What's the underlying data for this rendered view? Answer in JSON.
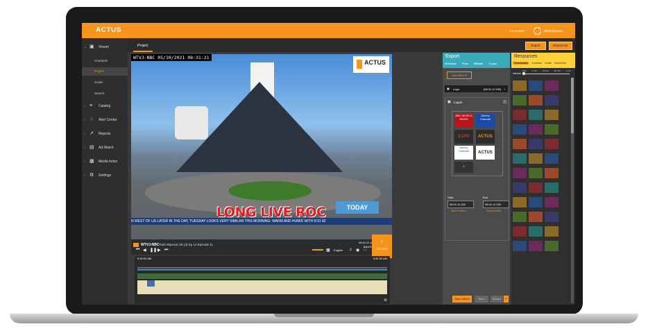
{
  "app": {
    "logo_text": "ACTUS",
    "topbar_info": "v.1.0.2020",
    "user": "admin@actus"
  },
  "sidebar": {
    "viewer": "Viewer",
    "viewer_items": [
      "Channels",
      "Project",
      "Guide",
      "Search"
    ],
    "active_item": "Project",
    "items": [
      {
        "label": "Catalog",
        "icon": "list-icon"
      },
      {
        "label": "Alert Center",
        "icon": "bell-icon"
      },
      {
        "label": "Reports",
        "icon": "chart-line-icon"
      },
      {
        "label": "Ad Watch",
        "icon": "document-icon"
      },
      {
        "label": "Media Index",
        "icon": "media-icon"
      },
      {
        "label": "Settings",
        "icon": "gear-icon"
      }
    ]
  },
  "header": {
    "project_tab": "Project",
    "export_btn": "Export",
    "resources_btn": "Resources"
  },
  "video": {
    "timestamp": "WTVJ-NBC  05/10/2021 08:31:21",
    "overlay_logo": "ACTUS",
    "banner": "LONG LIVE ROC",
    "today_badge": "TODAY",
    "ticker": "N WEST OF US LATER IN THE DAY, TUESDAY LOOKS VERY SIMILAR    THIS MORNING: WARM AND HUMID WITH   8:31  82"
  },
  "player": {
    "channel": "WTVJ-NBC",
    "program": "Total Wipeout UK (4) Ep 11-Episode 11",
    "time": "08:31:21 AM",
    "date": "5/10/21",
    "lang": "English",
    "go_live": "GO LIVE",
    "start_time": "8:30:00 AM",
    "end_time": "9:00:00 AM",
    "zoom_icon": "zoom-in-icon"
  },
  "export": {
    "title": "Export",
    "tabs": [
      "Metadata",
      "Parts",
      "Effects",
      "Output"
    ],
    "active_tab": "Effects",
    "add_effect": "Add Effect",
    "selected_effect": "Logo",
    "effect_time": "[08:31:11.330]",
    "logos_label": "Logos",
    "logo_tiles": [
      "BBC WORLD NEWS",
      "Disney Channel",
      "ESPN",
      "ACTUS",
      "Disney Channel",
      "ACTUS"
    ],
    "start_label": "Start",
    "end_label": "End",
    "start_value": "08:31:11.330",
    "end_value": "08:31:11.330",
    "save_to_video": "Save to video",
    "btn_save_advert": "Save Advert",
    "btn_save": "Save",
    "btn_export": "Export"
  },
  "resources": {
    "title": "Resources",
    "tabs": [
      "Thumbnails",
      "Subtitles",
      "Guide",
      "Waveform"
    ],
    "active_tab": "Thumbnails",
    "interval_label": "Interval",
    "interval_marks": [
      "auto",
      "5 min",
      "10 min",
      "30 min",
      "1 min"
    ]
  }
}
